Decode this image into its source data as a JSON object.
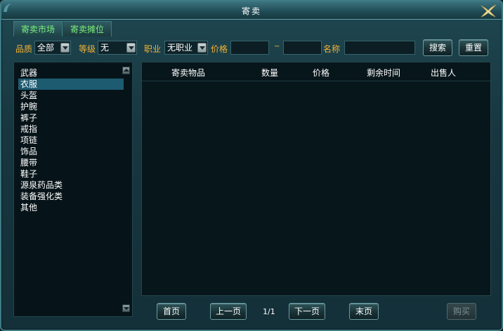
{
  "window": {
    "title": "寄卖"
  },
  "tabs": [
    {
      "label": "寄卖市场"
    },
    {
      "label": "寄卖摊位"
    }
  ],
  "filters": {
    "quality_label": "品质",
    "quality_value": "全部",
    "level_label": "等级",
    "level_value": "无",
    "job_label": "职业",
    "job_value": "无职业",
    "price_label": "价格",
    "price_min": "",
    "price_sep": "~",
    "price_max": "",
    "name_label": "名称",
    "name_value": "",
    "search_label": "搜索",
    "reset_label": "重置"
  },
  "categories": {
    "selected_index": 1,
    "items": [
      {
        "label": "武器"
      },
      {
        "label": "衣服"
      },
      {
        "label": "头盔"
      },
      {
        "label": "护腕"
      },
      {
        "label": "裤子"
      },
      {
        "label": "戒指"
      },
      {
        "label": "项链"
      },
      {
        "label": "饰品"
      },
      {
        "label": "腰带"
      },
      {
        "label": "鞋子"
      },
      {
        "label": "源泉药品类"
      },
      {
        "label": "装备强化类"
      },
      {
        "label": "其他"
      }
    ]
  },
  "table": {
    "headers": [
      {
        "label": "寄卖物品"
      },
      {
        "label": "数量"
      },
      {
        "label": "价格"
      },
      {
        "label": "剩余时间"
      },
      {
        "label": "出售人"
      }
    ],
    "rows": []
  },
  "pagination": {
    "first_label": "首页",
    "prev_label": "上一页",
    "page_indicator": "1/1",
    "next_label": "下一页",
    "last_label": "末页"
  },
  "buy_label": "购买",
  "colors": {
    "label_orange": "#f2b233",
    "tab_green": "#7cf07a",
    "selected_row": "#1d5b70"
  }
}
